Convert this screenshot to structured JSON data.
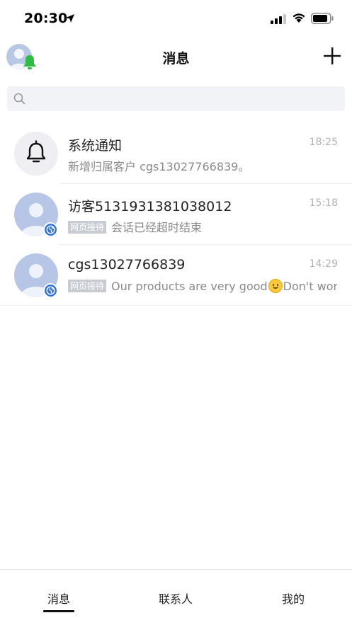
{
  "status_bar": {
    "time": "20:30"
  },
  "nav": {
    "title": "消息"
  },
  "search": {
    "placeholder": ""
  },
  "conversations": [
    {
      "name": "系统通知",
      "time": "18:25",
      "tag": "",
      "preview": "新增归属客户 cgs13027766839。",
      "avatar": "bell-icon"
    },
    {
      "name": "访客5131931381038012",
      "time": "15:18",
      "tag": "网页接待",
      "preview": "会话已经超时结束",
      "avatar": "user-avatar"
    },
    {
      "name": "cgs13027766839",
      "time": "14:29",
      "tag": "网页接待",
      "preview_before": "Our products are very good",
      "preview_after": "Don't wor",
      "avatar": "user-avatar"
    }
  ],
  "tabs": [
    {
      "label": "消息",
      "active": true
    },
    {
      "label": "联系人",
      "active": false
    },
    {
      "label": "我的",
      "active": false
    }
  ],
  "colors": {
    "accent_green": "#2ebd42",
    "badge_blue": "#2f74d6",
    "avatar_bg": "#b7c6e6"
  }
}
